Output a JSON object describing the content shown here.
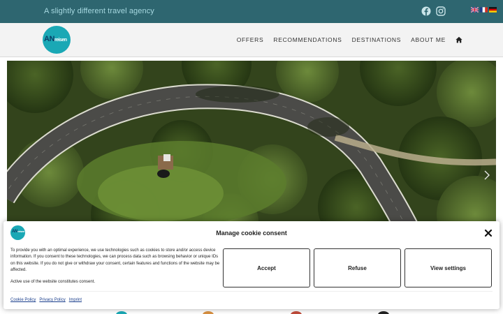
{
  "topbar": {
    "tagline": "A slightly different travel agency",
    "social": [
      {
        "icon": "facebook-icon"
      },
      {
        "icon": "instagram-icon"
      }
    ],
    "languages": [
      {
        "icon": "flag-uk-icon"
      },
      {
        "icon": "flag-fr-icon"
      },
      {
        "icon": "flag-de-icon"
      }
    ]
  },
  "nav": {
    "logo_main": "AN",
    "logo_sub": "reisen",
    "items": [
      "OFFERS",
      "RECOMMENDATIONS",
      "DESTINATIONS",
      "ABOUT ME"
    ],
    "home_icon": "home-icon"
  },
  "hero": {
    "next_icon": "chevron-right-icon"
  },
  "cookie": {
    "title": "Manage cookie consent",
    "description": "To provide you with an optimal experience, we use technologies such as cookies to store and/or access device information. If you consent to these technologies, we can process data such as browsing behavior or unique IDs on this website. If you do not give or withdraw your consent, certain features and functions of the website may be affected.",
    "description2": "Active use of the website constitutes consent.",
    "buttons": {
      "accept": "Accept",
      "refuse": "Refuse",
      "settings": "View settings"
    },
    "links": [
      "Cookie Policy",
      "Privacy Policy",
      "Imprint"
    ],
    "close_icon": "close-icon"
  },
  "colors": {
    "topbar_bg": "#2e6670",
    "tagline": "#a6d8e0",
    "logo_bg": "#1aa8b5",
    "nav_bg": "#f3f3f3",
    "link": "#1a3e8c"
  }
}
